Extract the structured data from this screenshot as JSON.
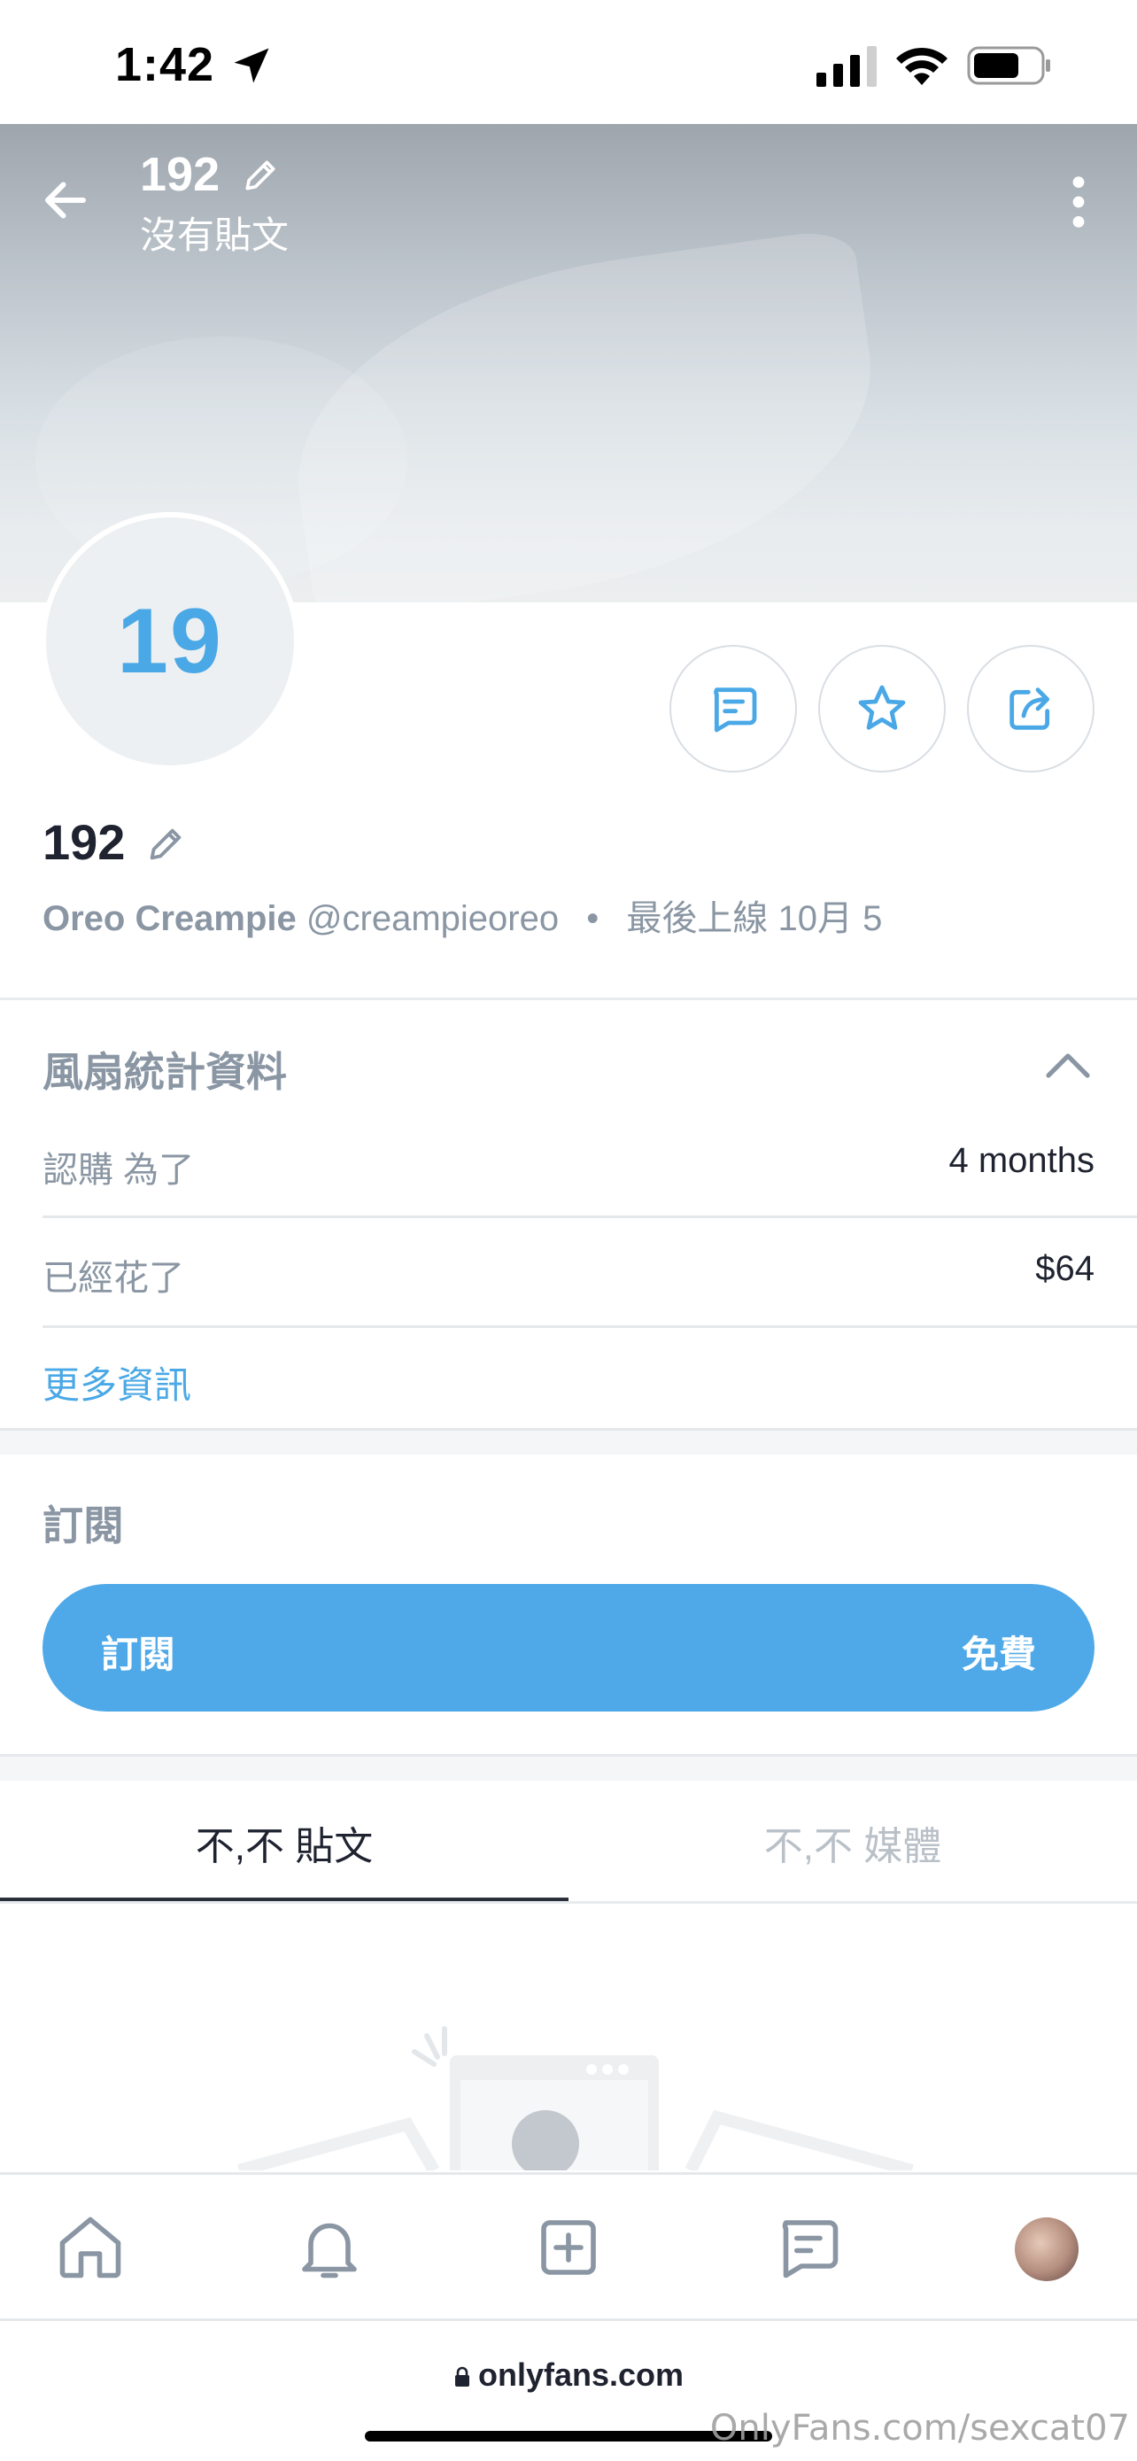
{
  "status_bar": {
    "time": "1:42"
  },
  "header": {
    "title": "192",
    "subtitle": "沒有貼文"
  },
  "profile": {
    "avatar_text": "19",
    "name": "192",
    "display_name": "Oreo Creampie",
    "username": "@creampieoreo",
    "separator": "•",
    "last_seen": "最後上線 10月 5"
  },
  "fan_stats": {
    "title": "風扇統計資料",
    "rows": [
      {
        "label": "認購 為了",
        "value": "4 months"
      },
      {
        "label": "已經花了",
        "value": "$64"
      }
    ],
    "more_info": "更多資訊"
  },
  "subscription": {
    "title": "訂閱",
    "button_left": "訂閱",
    "button_right": "免費"
  },
  "tabs": [
    {
      "label": "不,不 貼文",
      "active": true
    },
    {
      "label": "不,不 媒體",
      "active": false
    }
  ],
  "browser": {
    "url": "onlyfans.com",
    "watermark": "OnlyFans.com/sexcat07"
  },
  "colors": {
    "accent": "#4fa9e8",
    "muted": "#8a96a3",
    "text": "#1f2330"
  },
  "icons": {
    "header": [
      "back-arrow-icon",
      "pencil-icon",
      "more-vertical-icon"
    ],
    "actions": [
      "message-icon",
      "star-icon",
      "share-icon"
    ],
    "nav": [
      "home-icon",
      "bell-icon",
      "add-icon",
      "chat-icon",
      "avatar"
    ]
  }
}
